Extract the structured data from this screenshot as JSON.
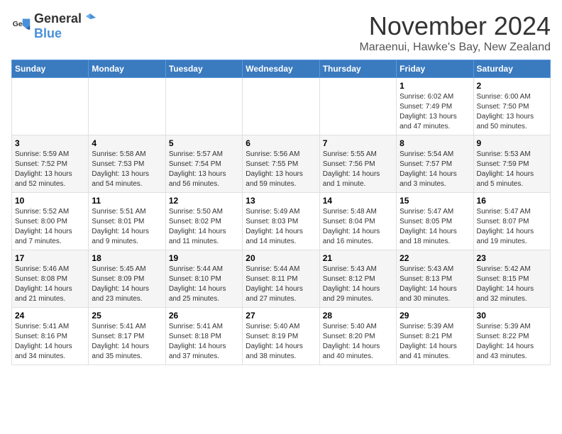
{
  "header": {
    "logo_general": "General",
    "logo_blue": "Blue",
    "month_title": "November 2024",
    "location": "Maraenui, Hawke's Bay, New Zealand"
  },
  "weekdays": [
    "Sunday",
    "Monday",
    "Tuesday",
    "Wednesday",
    "Thursday",
    "Friday",
    "Saturday"
  ],
  "weeks": [
    [
      {
        "day": "",
        "detail": ""
      },
      {
        "day": "",
        "detail": ""
      },
      {
        "day": "",
        "detail": ""
      },
      {
        "day": "",
        "detail": ""
      },
      {
        "day": "",
        "detail": ""
      },
      {
        "day": "1",
        "detail": "Sunrise: 6:02 AM\nSunset: 7:49 PM\nDaylight: 13 hours and 47 minutes."
      },
      {
        "day": "2",
        "detail": "Sunrise: 6:00 AM\nSunset: 7:50 PM\nDaylight: 13 hours and 50 minutes."
      }
    ],
    [
      {
        "day": "3",
        "detail": "Sunrise: 5:59 AM\nSunset: 7:52 PM\nDaylight: 13 hours and 52 minutes."
      },
      {
        "day": "4",
        "detail": "Sunrise: 5:58 AM\nSunset: 7:53 PM\nDaylight: 13 hours and 54 minutes."
      },
      {
        "day": "5",
        "detail": "Sunrise: 5:57 AM\nSunset: 7:54 PM\nDaylight: 13 hours and 56 minutes."
      },
      {
        "day": "6",
        "detail": "Sunrise: 5:56 AM\nSunset: 7:55 PM\nDaylight: 13 hours and 59 minutes."
      },
      {
        "day": "7",
        "detail": "Sunrise: 5:55 AM\nSunset: 7:56 PM\nDaylight: 14 hours and 1 minute."
      },
      {
        "day": "8",
        "detail": "Sunrise: 5:54 AM\nSunset: 7:57 PM\nDaylight: 14 hours and 3 minutes."
      },
      {
        "day": "9",
        "detail": "Sunrise: 5:53 AM\nSunset: 7:59 PM\nDaylight: 14 hours and 5 minutes."
      }
    ],
    [
      {
        "day": "10",
        "detail": "Sunrise: 5:52 AM\nSunset: 8:00 PM\nDaylight: 14 hours and 7 minutes."
      },
      {
        "day": "11",
        "detail": "Sunrise: 5:51 AM\nSunset: 8:01 PM\nDaylight: 14 hours and 9 minutes."
      },
      {
        "day": "12",
        "detail": "Sunrise: 5:50 AM\nSunset: 8:02 PM\nDaylight: 14 hours and 11 minutes."
      },
      {
        "day": "13",
        "detail": "Sunrise: 5:49 AM\nSunset: 8:03 PM\nDaylight: 14 hours and 14 minutes."
      },
      {
        "day": "14",
        "detail": "Sunrise: 5:48 AM\nSunset: 8:04 PM\nDaylight: 14 hours and 16 minutes."
      },
      {
        "day": "15",
        "detail": "Sunrise: 5:47 AM\nSunset: 8:05 PM\nDaylight: 14 hours and 18 minutes."
      },
      {
        "day": "16",
        "detail": "Sunrise: 5:47 AM\nSunset: 8:07 PM\nDaylight: 14 hours and 19 minutes."
      }
    ],
    [
      {
        "day": "17",
        "detail": "Sunrise: 5:46 AM\nSunset: 8:08 PM\nDaylight: 14 hours and 21 minutes."
      },
      {
        "day": "18",
        "detail": "Sunrise: 5:45 AM\nSunset: 8:09 PM\nDaylight: 14 hours and 23 minutes."
      },
      {
        "day": "19",
        "detail": "Sunrise: 5:44 AM\nSunset: 8:10 PM\nDaylight: 14 hours and 25 minutes."
      },
      {
        "day": "20",
        "detail": "Sunrise: 5:44 AM\nSunset: 8:11 PM\nDaylight: 14 hours and 27 minutes."
      },
      {
        "day": "21",
        "detail": "Sunrise: 5:43 AM\nSunset: 8:12 PM\nDaylight: 14 hours and 29 minutes."
      },
      {
        "day": "22",
        "detail": "Sunrise: 5:43 AM\nSunset: 8:13 PM\nDaylight: 14 hours and 30 minutes."
      },
      {
        "day": "23",
        "detail": "Sunrise: 5:42 AM\nSunset: 8:15 PM\nDaylight: 14 hours and 32 minutes."
      }
    ],
    [
      {
        "day": "24",
        "detail": "Sunrise: 5:41 AM\nSunset: 8:16 PM\nDaylight: 14 hours and 34 minutes."
      },
      {
        "day": "25",
        "detail": "Sunrise: 5:41 AM\nSunset: 8:17 PM\nDaylight: 14 hours and 35 minutes."
      },
      {
        "day": "26",
        "detail": "Sunrise: 5:41 AM\nSunset: 8:18 PM\nDaylight: 14 hours and 37 minutes."
      },
      {
        "day": "27",
        "detail": "Sunrise: 5:40 AM\nSunset: 8:19 PM\nDaylight: 14 hours and 38 minutes."
      },
      {
        "day": "28",
        "detail": "Sunrise: 5:40 AM\nSunset: 8:20 PM\nDaylight: 14 hours and 40 minutes."
      },
      {
        "day": "29",
        "detail": "Sunrise: 5:39 AM\nSunset: 8:21 PM\nDaylight: 14 hours and 41 minutes."
      },
      {
        "day": "30",
        "detail": "Sunrise: 5:39 AM\nSunset: 8:22 PM\nDaylight: 14 hours and 43 minutes."
      }
    ]
  ]
}
